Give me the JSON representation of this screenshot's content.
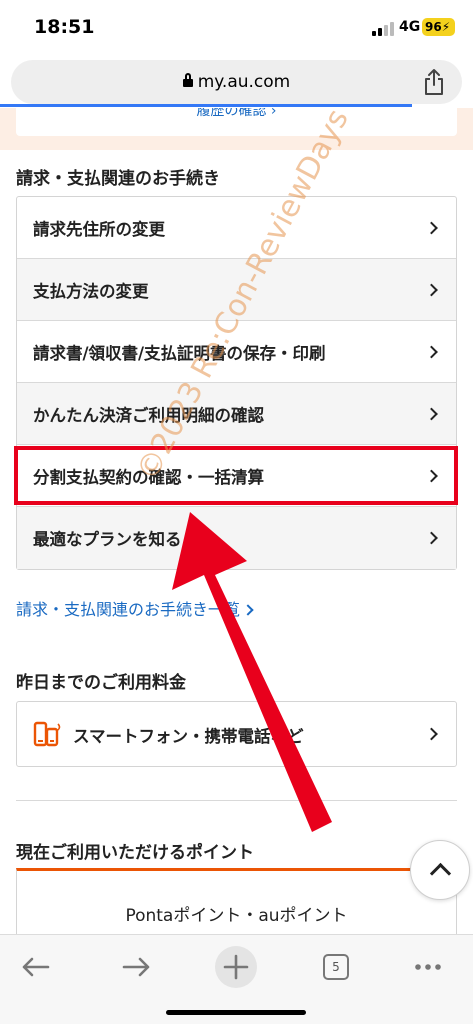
{
  "status": {
    "time": "18:51",
    "network": "4G",
    "battery": "96"
  },
  "browser": {
    "url": "my.au.com",
    "tab_count": "5"
  },
  "top_card": {
    "link_label": "履歴の確認 ›"
  },
  "billing_section": {
    "title": "請求・支払関連のお手続き",
    "items": [
      {
        "label": "請求先住所の変更"
      },
      {
        "label": "支払方法の変更"
      },
      {
        "label": "請求書/領収書/支払証明書の保存・印刷"
      },
      {
        "label": "かんたん決済ご利用明細の確認"
      },
      {
        "label": "分割支払契約の確認・一括清算"
      },
      {
        "label": "最適なプランを知る"
      }
    ],
    "all_link": "請求・支払関連のお手続き一覧"
  },
  "usage_section": {
    "title": "昨日までのご利用料金",
    "item_label": "スマートフォン・携帯電話など"
  },
  "points_section": {
    "title": "現在ご利用いただけるポイント",
    "card_label": "Pontaポイント・auポイント"
  },
  "watermark": "©2023 Re:Con-ReviewDays",
  "colors": {
    "highlight": "#e8001c",
    "link": "#1a6ac2",
    "accent": "#eb5505",
    "progress": "#3478f6"
  }
}
